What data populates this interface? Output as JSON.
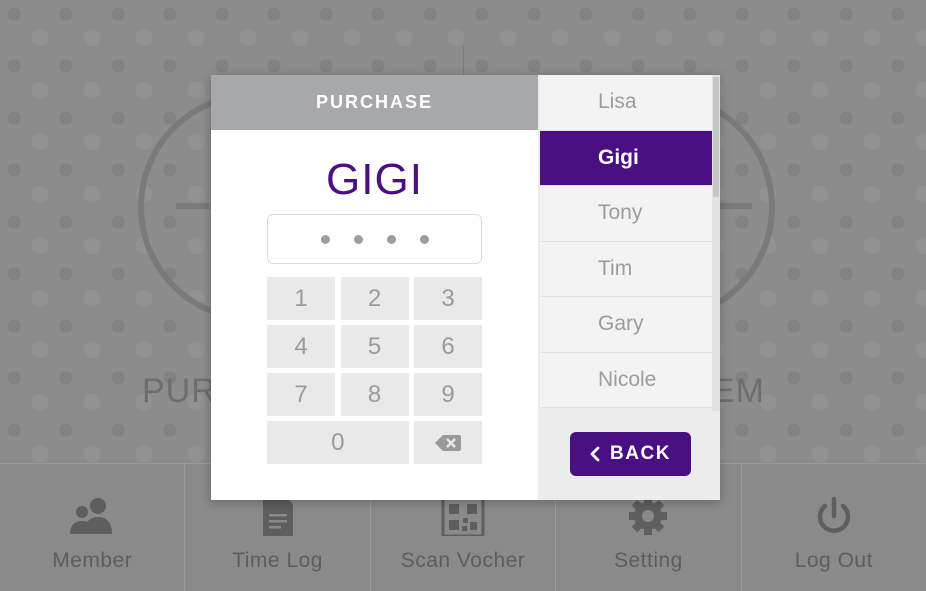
{
  "background": {
    "left_label": "PUR",
    "right_label": "EM"
  },
  "bottom_nav": {
    "items": [
      {
        "label": "Member",
        "icon": "members-icon"
      },
      {
        "label": "Time Log",
        "icon": "document-icon"
      },
      {
        "label": "Scan Vocher",
        "icon": "qr-code-icon"
      },
      {
        "label": "Setting",
        "icon": "gear-icon"
      },
      {
        "label": "Log Out",
        "icon": "power-icon"
      }
    ]
  },
  "modal": {
    "title": "PURCHASE",
    "selected_name": "GIGI",
    "pin_length": 4,
    "keypad": [
      "1",
      "2",
      "3",
      "4",
      "5",
      "6",
      "7",
      "8",
      "9",
      "0"
    ],
    "backspace_icon": "backspace-icon",
    "names": [
      "Lisa",
      "Gigi",
      "Tony",
      "Tim",
      "Gary",
      "Nicole"
    ],
    "active_name": "Gigi",
    "back_label": "BACK"
  },
  "colors": {
    "accent": "#4b0f84",
    "header": "#a7a8aa",
    "overlay": "#8c8c8c"
  }
}
